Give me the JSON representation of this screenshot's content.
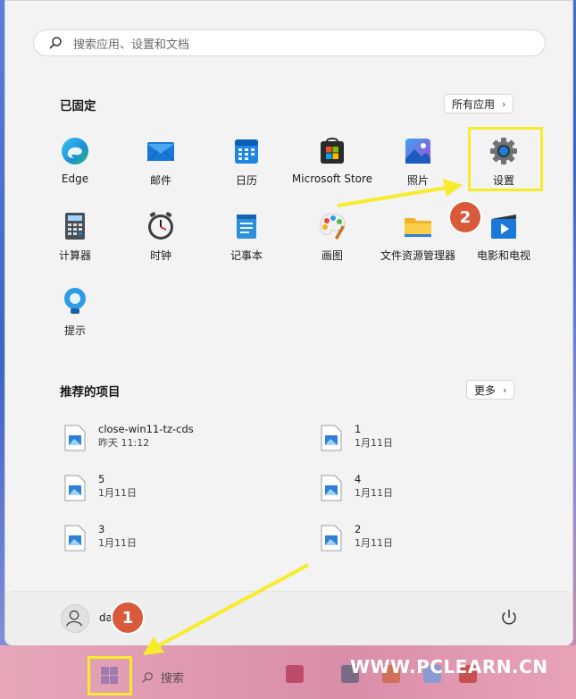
{
  "search": {
    "placeholder": "搜索应用、设置和文档"
  },
  "pinned": {
    "title": "已固定",
    "all_apps_label": "所有应用",
    "apps": [
      {
        "label": "Edge",
        "icon": "edge-icon"
      },
      {
        "label": "邮件",
        "icon": "mail-icon"
      },
      {
        "label": "日历",
        "icon": "calendar-icon"
      },
      {
        "label": "Microsoft Store",
        "icon": "store-icon"
      },
      {
        "label": "照片",
        "icon": "photos-icon"
      },
      {
        "label": "设置",
        "icon": "gear-icon"
      },
      {
        "label": "计算器",
        "icon": "calculator-icon"
      },
      {
        "label": "时钟",
        "icon": "clock-icon"
      },
      {
        "label": "记事本",
        "icon": "notepad-icon"
      },
      {
        "label": "画图",
        "icon": "paint-icon"
      },
      {
        "label": "文件资源管理器",
        "icon": "folder-icon"
      },
      {
        "label": "电影和电视",
        "icon": "movies-icon"
      },
      {
        "label": "提示",
        "icon": "tips-icon"
      }
    ]
  },
  "recommended": {
    "title": "推荐的项目",
    "more_label": "更多",
    "items": [
      {
        "name": "close-win11-tz-cds",
        "time": "昨天 11:12"
      },
      {
        "name": "1",
        "time": "1月11日"
      },
      {
        "name": "5",
        "time": "1月11日"
      },
      {
        "name": "4",
        "time": "1月11日"
      },
      {
        "name": "3",
        "time": "1月11日"
      },
      {
        "name": "2",
        "time": "1月11日"
      }
    ]
  },
  "user": {
    "name": "dayang"
  },
  "taskbar": {
    "search_label": "搜索",
    "watermark": "WWW.PCLEARN.CN"
  },
  "callouts": [
    "1",
    "2"
  ],
  "colors": {
    "highlight": "#f7ec2b",
    "callout": "#d95a3a"
  }
}
